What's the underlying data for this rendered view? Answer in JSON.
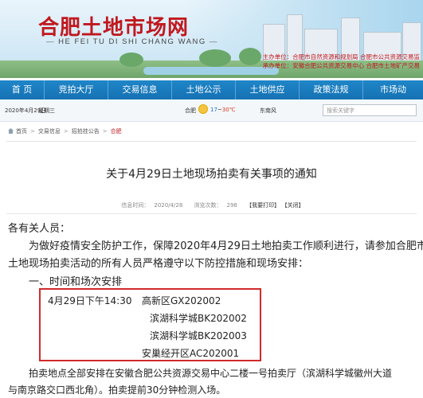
{
  "header": {
    "title": "合肥土地市场网",
    "subtitle": "HE FEI TU DI SHI CHANG WANG",
    "host_line1": "主办单位：合肥市自然资源和规划局  合肥市公共资源交易监",
    "host_line2": "承办单位：安徽合肥公共资源交易中心  合肥市土地矿产交易"
  },
  "nav": [
    "首 页",
    "竞拍大厅",
    "交易信息",
    "土地公示",
    "土地供应",
    "政策法规",
    "市场动"
  ],
  "infobar": {
    "date": "2020年4月29日",
    "weekday": "星期三",
    "city": "合肥",
    "temp_low": "17",
    "temp_sep": "~",
    "temp_high": "30℃",
    "wind": "东南风",
    "search_placeholder": "搜索关键字"
  },
  "breadcrumb": {
    "home": "首页",
    "level1": "交易信息",
    "level2": "招拍挂公告",
    "current": "合肥"
  },
  "article": {
    "title": "关于4月29日土地现场拍卖有关事项的通知",
    "source_label": "信息时间：",
    "source_date": "2020/4/28",
    "views_label": "浏览次数：",
    "views": "298",
    "print": "【我要打印】",
    "close": "【关闭】",
    "greeting": "各有关人员：",
    "para1_a": "为做好疫情安全防护工作，保障2020年4月29日土地拍卖工作顺利进行，请参加合肥市",
    "para1_b": "土地现场拍卖活动的所有人员严格遵守以下防控措施和现场安排：",
    "section1": "一、时间和场次安排",
    "schedule_time": "4月29日下午14:30",
    "schedule": [
      "高新区GX202002",
      "滨湖科学城BK202002",
      "滨湖科学城BK202003",
      "安巢经开区AC202001"
    ],
    "para2_a": "拍卖地点全部安排在安徽合肥公共资源交易中心二楼一号拍卖厅（滨湖科学城徽州大道",
    "para2_b": "与南京路交口西北角）。拍卖提前30分钟检测入场。"
  }
}
